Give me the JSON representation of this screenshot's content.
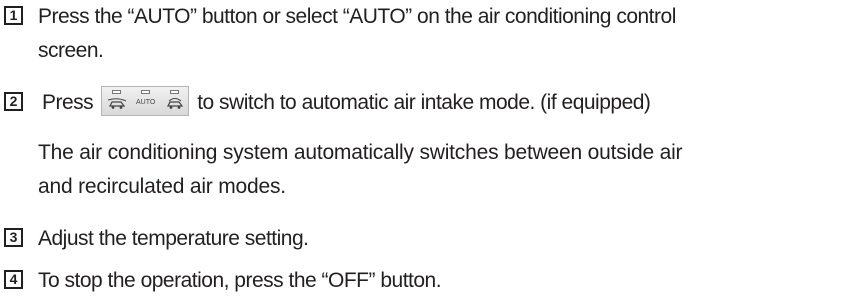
{
  "steps": [
    {
      "number": "1",
      "lines": [
        "Press the “AUTO” button or select “AUTO” on the air conditioning control",
        "screen."
      ]
    },
    {
      "number": "2",
      "before": "Press",
      "after": "to switch to automatic air intake mode. (if equipped)",
      "panel": {
        "buttons": [
          {
            "icon": "outside-air-icon"
          },
          {
            "label": "AUTO"
          },
          {
            "icon": "recirculate-air-icon"
          }
        ]
      },
      "note_lines": [
        "The air conditioning system automatically switches between outside air",
        "and recirculated air modes."
      ]
    },
    {
      "number": "3",
      "text": "Adjust the temperature setting."
    },
    {
      "number": "4",
      "text": "To stop the operation, press the “OFF” button."
    }
  ]
}
